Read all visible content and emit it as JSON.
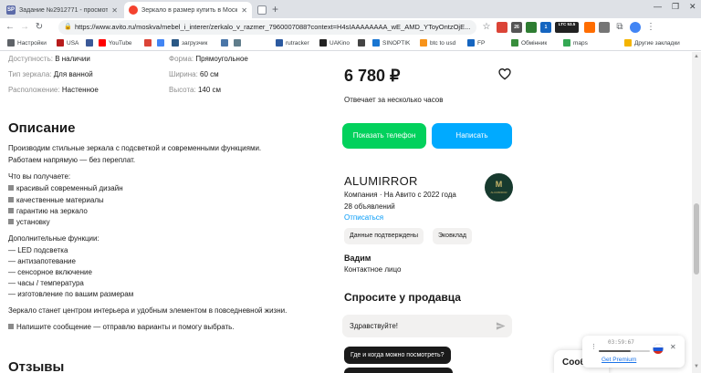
{
  "browser": {
    "tabs": [
      {
        "title": "Задание №2912771 - просмотр з",
        "favicon_text": "SP",
        "favicon_color": "#5b6aa8",
        "active": false
      },
      {
        "title": "Зеркало в размер купить в Моск",
        "favicon_text": "a",
        "favicon_color": "#f4422f",
        "active": true
      },
      {
        "title": "",
        "favicon_text": "",
        "favicon_color": "#8a8f98",
        "active": false
      }
    ],
    "url": "https://www.avito.ru/moskva/mebel_i_interer/zerkalo_v_razmer_7960007088?context=H4sIAAAAAAAA_wE_AMD_YToyOntzOjE...",
    "extensions": [
      {
        "label": "",
        "color": "#db4437"
      },
      {
        "label": "26",
        "color": "#555555"
      },
      {
        "label": "",
        "color": "#2e7d32"
      },
      {
        "label": "1",
        "color": "#1565c0"
      },
      {
        "label": "LTC 53.5",
        "color": "#222222"
      },
      {
        "label": "",
        "color": "#ff6d00"
      },
      {
        "label": "",
        "color": "#757575"
      }
    ],
    "bookmarks": [
      {
        "label": "Настройки",
        "color": "#5f6368"
      },
      {
        "label": "USA",
        "color": "#b71c1c"
      },
      {
        "label": "",
        "color": "#3b5998"
      },
      {
        "label": "YouTube",
        "color": "#ff0000"
      },
      {
        "label": "",
        "color": "#db4437"
      },
      {
        "label": "",
        "color": "#4285f4"
      },
      {
        "label": "загрузчик",
        "color": "#2a5885"
      },
      {
        "label": "",
        "color": "#4a76a8"
      },
      {
        "label": "",
        "color": "#607d8b"
      },
      {
        "label": "rutracker",
        "color": "#2c5aa0"
      },
      {
        "label": "UAKino",
        "color": "#222222"
      },
      {
        "label": "",
        "color": "#444444"
      },
      {
        "label": "SINOPTIK",
        "color": "#1976d2"
      },
      {
        "label": "btc to usd",
        "color": "#f7931a"
      },
      {
        "label": "FP",
        "color": "#1565c0"
      },
      {
        "label": "Обмінник",
        "color": "#388e3c"
      },
      {
        "label": "maps",
        "color": "#34a853"
      },
      {
        "label": "Другие закладки",
        "color": "#f4b400"
      }
    ]
  },
  "params": [
    {
      "key": "Доступность:",
      "value": "В наличии"
    },
    {
      "key": "Тип зеркала:",
      "value": "Для ванной"
    },
    {
      "key": "Расположение:",
      "value": "Настенное"
    },
    {
      "key": "Форма:",
      "value": "Прямоугольное"
    },
    {
      "key": "Ширина:",
      "value": "60 см"
    },
    {
      "key": "Высота:",
      "value": "140 см"
    }
  ],
  "description": {
    "heading": "Описание",
    "lines": [
      "Производим стильные зеркала с подсветкой и современными функциями.",
      "Работаем напрямую — без переплат.",
      "Что вы получаете:",
      "красивый современный дизайн",
      "качественные материалы",
      "гарантию на зеркало",
      "установку",
      "Дополнительные функции:",
      "— LED подсветка",
      "— антизапотевание",
      "— сенсорное включение",
      "— часы / температура",
      "— изготовление по вашим размерам",
      "Зеркало станет центром интерьера и удобным элементом в повседневной жизни.",
      "Напишите сообщение — отправлю варианты и помогу выбрать."
    ]
  },
  "reviews_heading": "Отзывы",
  "listing": {
    "price": "6 780 ₽",
    "reply_time": "Отвечает за несколько часов",
    "phone_button": "Показать телефон",
    "write_button": "Написать"
  },
  "seller": {
    "name": "ALUMIRROR",
    "logo_letter": "M",
    "logo_caption": "ALUMIRROR",
    "info": "Компания · На Авито с 2022 года",
    "ads_count": "28 объявлений",
    "unsubscribe": "Отписаться",
    "chips": [
      "Данные подтверждены",
      "Эковклад"
    ]
  },
  "contact": {
    "name": "Вадим",
    "role": "Контактное лицо"
  },
  "ask": {
    "heading": "Спросите у продавца",
    "input_value": "Здравствуйте!",
    "questions": [
      "Где и когда можно посмотреть?",
      ""
    ]
  },
  "messages_tab": "Сооб",
  "player": {
    "time": "03:59:67",
    "premium_link": "Get Premium",
    "progress": 0.62
  }
}
